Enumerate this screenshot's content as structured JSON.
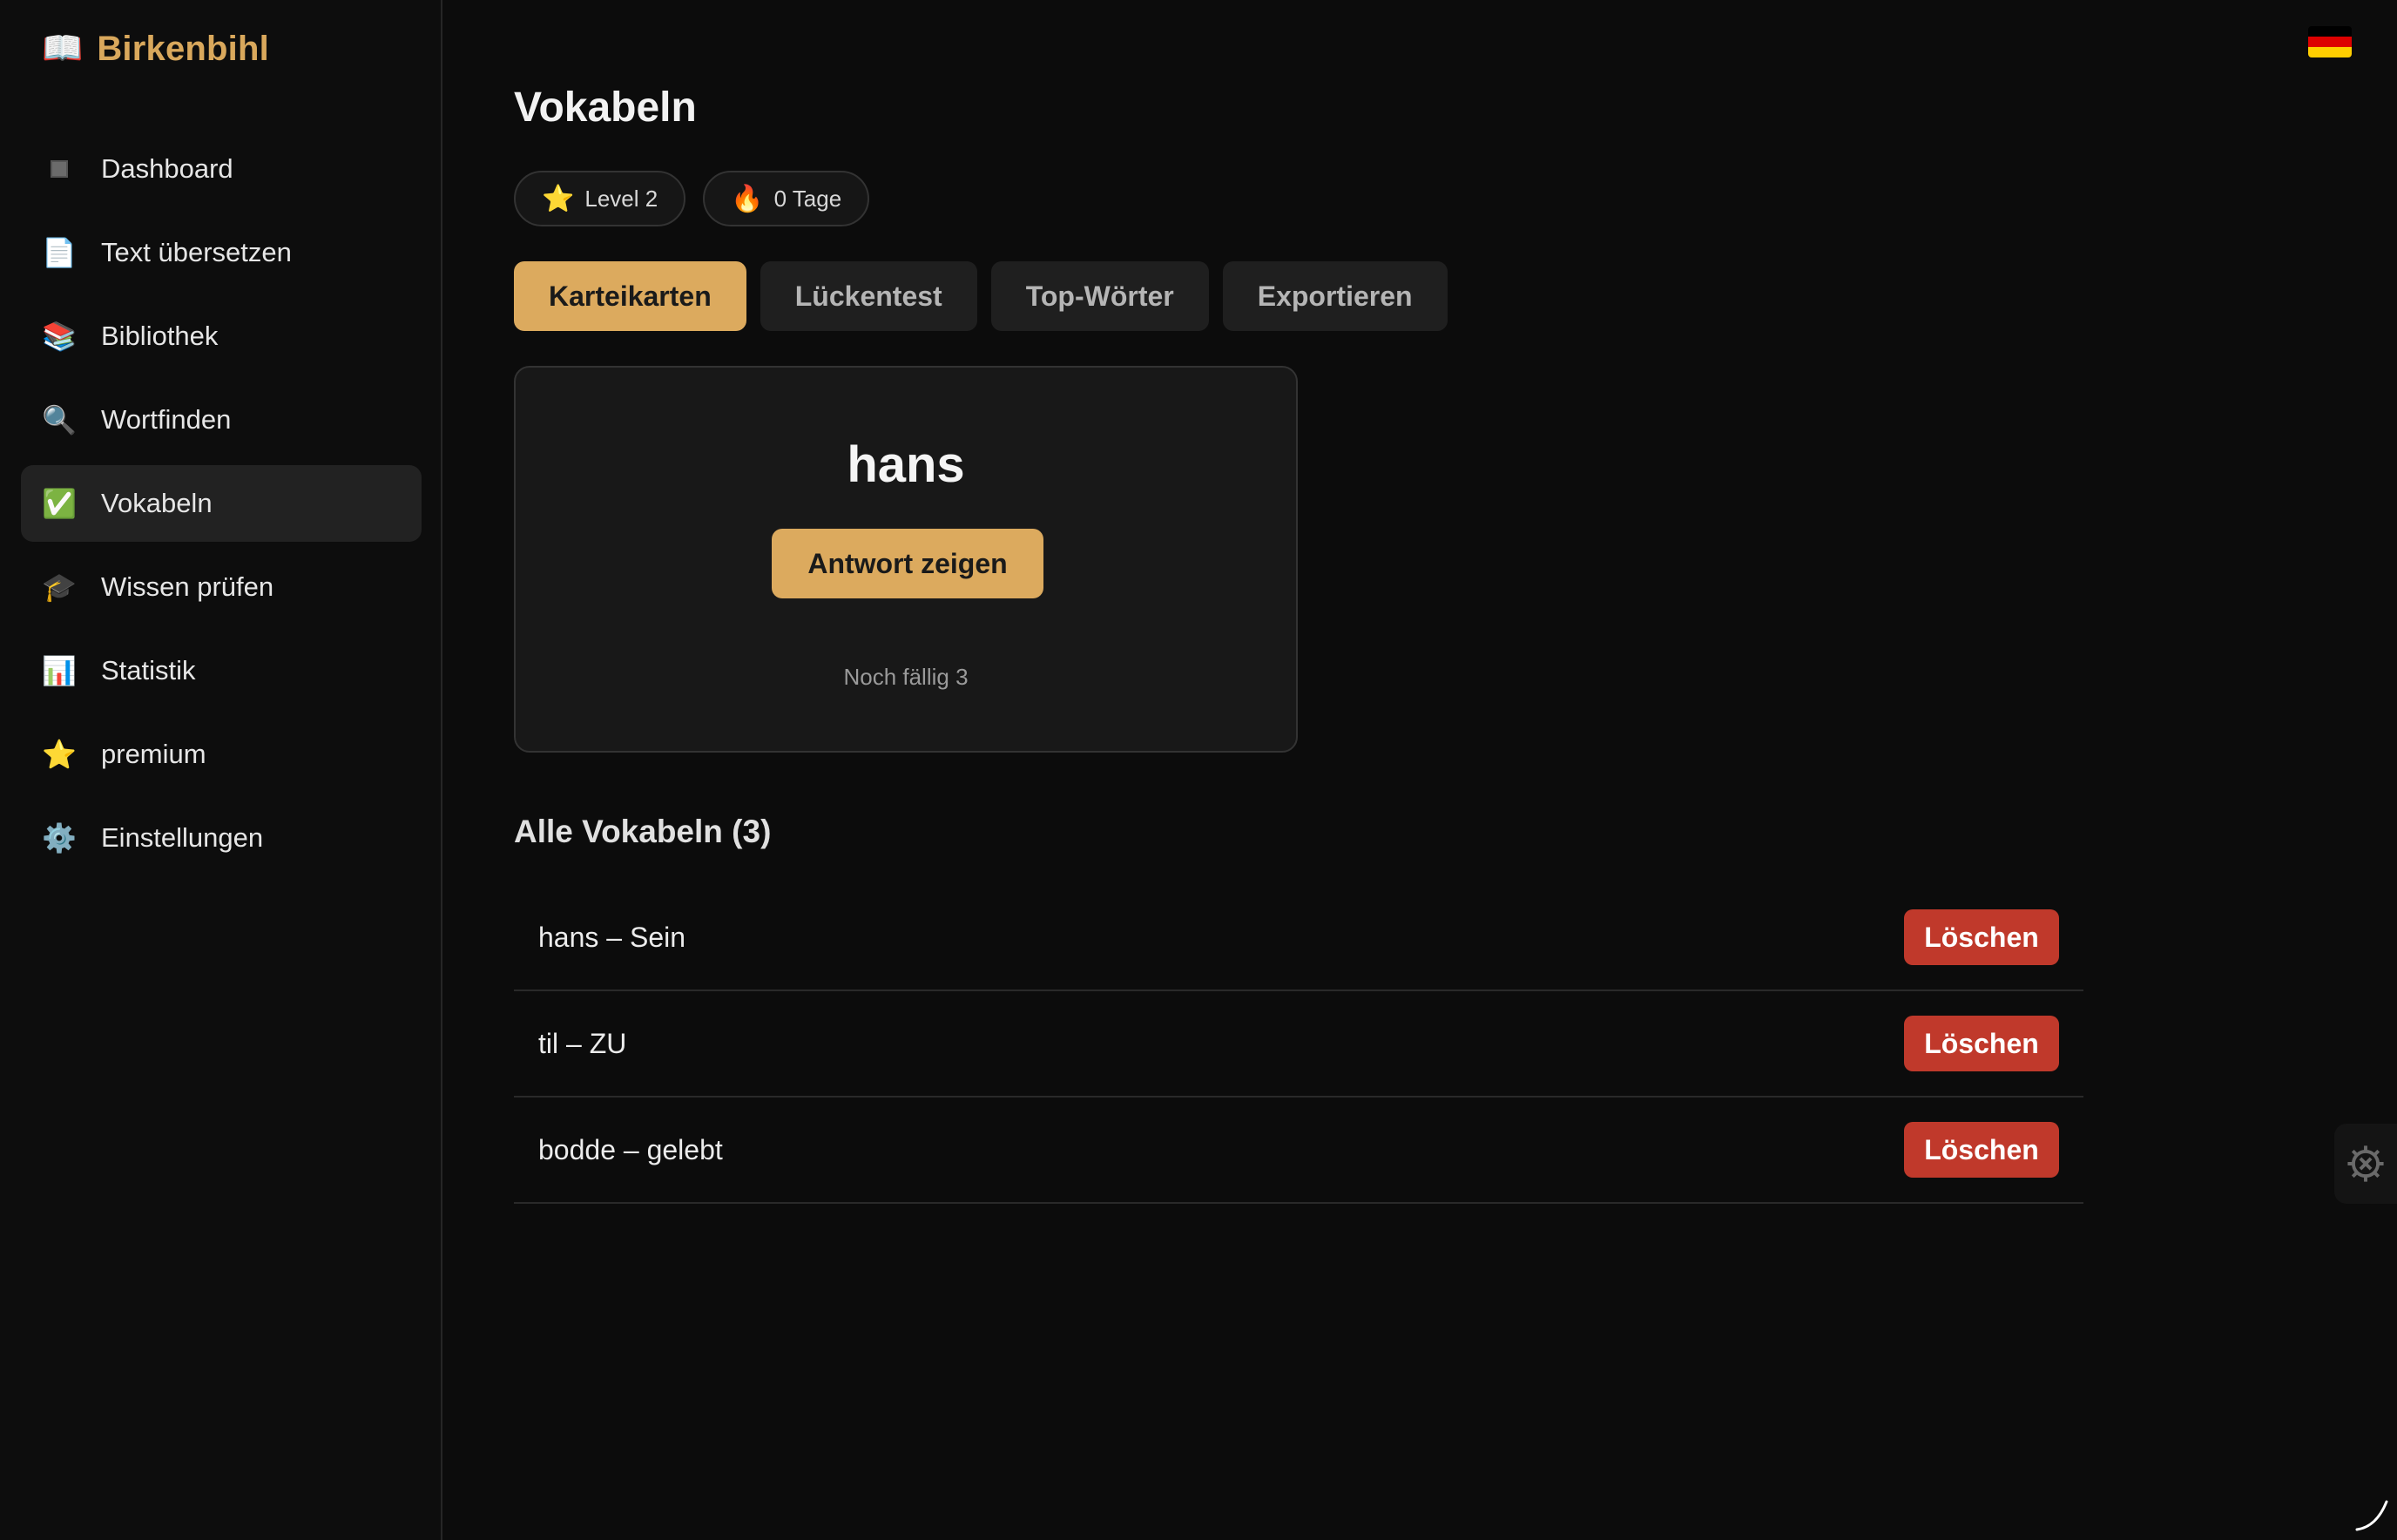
{
  "app": {
    "name": "Birkenbihl",
    "brand_icon": "open-book-icon"
  },
  "sidebar": {
    "items": [
      {
        "label": "Dashboard",
        "icon": "dashboard-grid-icon"
      },
      {
        "label": "Text übersetzen",
        "icon": "page-icon"
      },
      {
        "label": "Bibliothek",
        "icon": "books-icon"
      },
      {
        "label": "Wortfinden",
        "icon": "magnifier-icon"
      },
      {
        "label": "Vokabeln",
        "icon": "check-mark-icon",
        "active": true
      },
      {
        "label": "Wissen prüfen",
        "icon": "graduation-cap-icon"
      },
      {
        "label": "Statistik",
        "icon": "bar-chart-icon"
      },
      {
        "label": "premium",
        "icon": "star-icon"
      },
      {
        "label": "Einstellungen",
        "icon": "gear-icon"
      }
    ]
  },
  "header": {
    "language_flag": "german-flag-icon"
  },
  "page": {
    "title": "Vokabeln",
    "badges": {
      "level": "Level 2",
      "streak": "0 Tage"
    },
    "tabs": [
      {
        "label": "Karteikarten",
        "active": true
      },
      {
        "label": "Lückentest"
      },
      {
        "label": "Top-Wörter"
      },
      {
        "label": "Exportieren"
      }
    ],
    "flashcard": {
      "word": "hans",
      "show_answer_label": "Antwort zeigen",
      "due_text": "Noch fällig 3"
    },
    "all_vocab": {
      "title": "Alle Vokabeln (3)",
      "delete_label": "Löschen",
      "rows": [
        "hans – Sein",
        "til – ZU",
        "bodde – gelebt"
      ]
    }
  },
  "colors": {
    "accent": "#dcaa5e",
    "brand_text": "#d9a85c",
    "danger": "#c0392b",
    "background": "#0c0c0c",
    "active_nav": "#222222"
  }
}
